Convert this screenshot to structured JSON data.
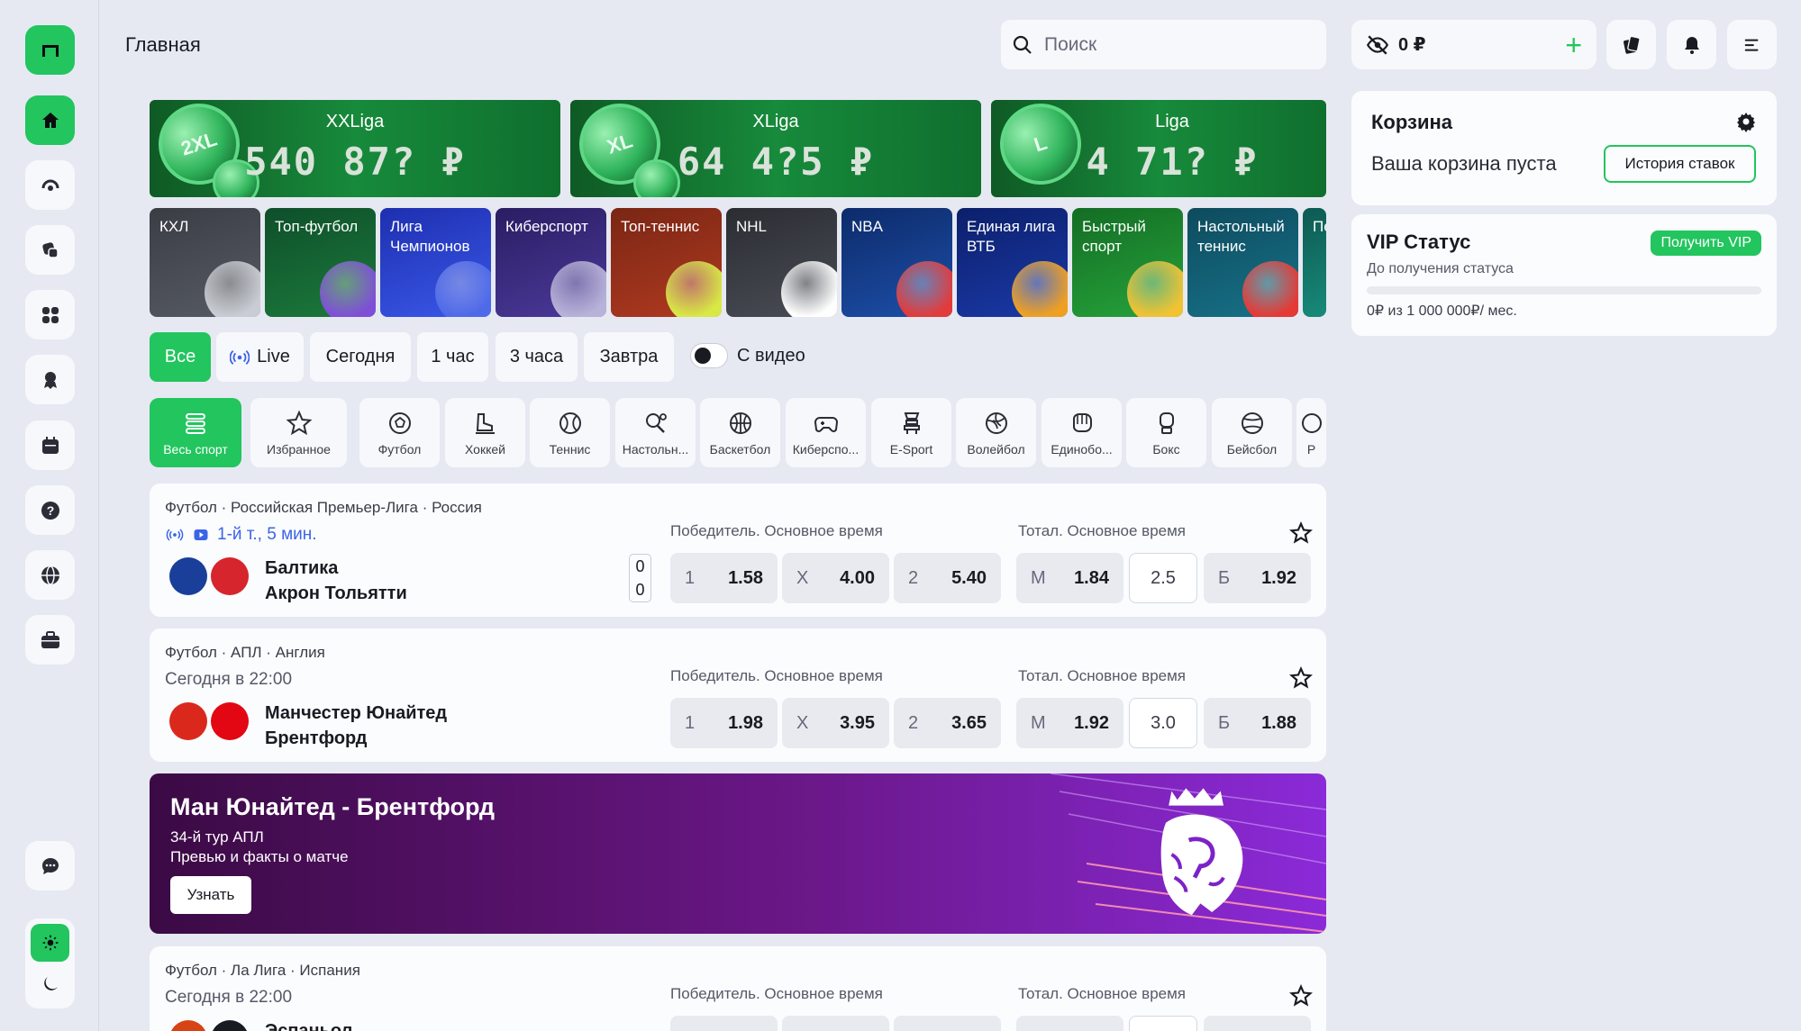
{
  "header": {
    "title": "Главная",
    "search_placeholder": "Поиск",
    "balance": "0 ₽"
  },
  "sidebar": {
    "items": [
      {
        "icon": "home-icon"
      },
      {
        "icon": "live-broadcast-icon"
      },
      {
        "icon": "casino-dice-icon"
      },
      {
        "icon": "games-grid-icon"
      },
      {
        "icon": "award-icon"
      },
      {
        "icon": "calendar-icon"
      },
      {
        "icon": "help-icon"
      },
      {
        "icon": "globe-icon"
      },
      {
        "icon": "briefcase-icon"
      },
      {
        "icon": "chat-icon"
      }
    ]
  },
  "promos": [
    {
      "name": "XXLiga",
      "amount": "540 87? ₽",
      "coin": "2XL"
    },
    {
      "name": "XLiga",
      "amount": "64 4?5 ₽",
      "coin": "XL"
    },
    {
      "name": "Liga",
      "amount": "4 71? ₽",
      "coin": "L"
    }
  ],
  "categories": [
    {
      "label": "КХЛ",
      "colors": [
        "#3a3d44",
        "#575b63"
      ],
      "art": "#c9ccd2"
    },
    {
      "label": "Топ-футбол",
      "colors": [
        "#0e4f2a",
        "#1c7a3c"
      ],
      "art": "#7e4fd6"
    },
    {
      "label": "Лига Чемпионов",
      "colors": [
        "#1e2fb0",
        "#3a58e8"
      ],
      "art": "#4f6ae8"
    },
    {
      "label": "Киберспорт",
      "colors": [
        "#2b1d63",
        "#4b3a9a"
      ],
      "art": "#b7b2d8"
    },
    {
      "label": "Топ-теннис",
      "colors": [
        "#7a2615",
        "#b03a1f"
      ],
      "art": "#d8e845"
    },
    {
      "label": "NHL",
      "colors": [
        "#2b2d33",
        "#4a4d55"
      ],
      "art": "#ffffff"
    },
    {
      "label": "NBA",
      "colors": [
        "#0d2b6b",
        "#1d4fa8"
      ],
      "art": "#e23b3b"
    },
    {
      "label": "Единая лига ВТБ",
      "colors": [
        "#0c1f6b",
        "#1a3aa8"
      ],
      "art": "#f0a020"
    },
    {
      "label": "Быстрый спорт",
      "colors": [
        "#136d24",
        "#27a33b"
      ],
      "art": "#f1c232"
    },
    {
      "label": "Настольный теннис",
      "colors": [
        "#0e4b5e",
        "#177289"
      ],
      "art": "#e53935"
    },
    {
      "label": "Пе ли",
      "colors": [
        "#0e5a52",
        "#178a7a"
      ],
      "art": "#1c6f66"
    }
  ],
  "filters": {
    "chips": [
      "Все",
      "Live",
      "Сегодня",
      "1 час",
      "3 часа",
      "Завтра"
    ],
    "video_toggle": "С видео"
  },
  "sports": [
    {
      "label": "Весь спорт",
      "icon": "all-sports-icon"
    },
    {
      "label": "Избранное",
      "icon": "star-icon"
    },
    {
      "label": "Футбол",
      "icon": "soccer-ball-icon"
    },
    {
      "label": "Хоккей",
      "icon": "hockey-skate-icon"
    },
    {
      "label": "Теннис",
      "icon": "tennis-ball-icon"
    },
    {
      "label": "Настольн...",
      "icon": "table-tennis-icon"
    },
    {
      "label": "Баскетбол",
      "icon": "basketball-icon"
    },
    {
      "label": "Киберспо...",
      "icon": "gamepad-icon"
    },
    {
      "label": "E-Sport",
      "icon": "esport-icon"
    },
    {
      "label": "Волейбол",
      "icon": "volleyball-icon"
    },
    {
      "label": "Единобо...",
      "icon": "boxing-glove-icon"
    },
    {
      "label": "Бокс",
      "icon": "boxing-icon"
    },
    {
      "label": "Бейсбол",
      "icon": "baseball-icon"
    },
    {
      "label": "Р",
      "icon": "more-sport-icon"
    }
  ],
  "groups": {
    "winner": "Победитель. Основное время",
    "total": "Тотал. Основное время"
  },
  "matches": [
    {
      "meta": "Футбол · Российская Премьер-Лига · Россия",
      "time": "1-й т., 5 мин.",
      "live": true,
      "team1": "Балтика",
      "team2": "Акрон Тольятти",
      "score1": "0",
      "score2": "0",
      "logo1": "#1a3f9a",
      "logo2": "#d6252c",
      "odds": {
        "w1": "1.58",
        "x": "4.00",
        "w2": "5.40",
        "under": "1.84",
        "total": "2.5",
        "over": "1.92"
      }
    },
    {
      "meta": "Футбол · АПЛ · Англия",
      "time": "Сегодня в 22:00",
      "live": false,
      "team1": "Манчестер Юнайтед",
      "team2": "Брентфорд",
      "logo1": "#da291c",
      "logo2": "#e30613",
      "odds": {
        "w1": "1.98",
        "x": "3.95",
        "w2": "3.65",
        "under": "1.92",
        "total": "3.0",
        "over": "1.88"
      }
    },
    {
      "meta": "Футбол · Ла Лига · Испания",
      "time": "Сегодня в 22:00",
      "live": false,
      "team1": "Эспаньол",
      "team2": "",
      "logo1": "#d84315",
      "logo2": "#1a1b22",
      "odds": {
        "w1": "",
        "x": "",
        "w2": "",
        "under": "",
        "total": "",
        "over": ""
      }
    }
  ],
  "odd_labels": {
    "w1": "1",
    "x": "X",
    "w2": "2",
    "under": "М",
    "over": "Б"
  },
  "epl_promo": {
    "title": "Ман Юнайтед - Брентфорд",
    "line1": "34-й тур АПЛ",
    "line2": "Превью и факты о матче",
    "button": "Узнать"
  },
  "cart": {
    "title": "Корзина",
    "empty_text": "Ваша корзина пуста",
    "history_button": "История ставок"
  },
  "vip": {
    "title": "VIP Статус",
    "button": "Получить VIP",
    "subtitle": "До получения статуса",
    "progress_text": "0₽ из 1 000 000₽/ мес.",
    "progress": 0
  },
  "colors": {
    "accent": "#22c55e",
    "live": "#3a64e8",
    "background": "#e6e9f2"
  }
}
